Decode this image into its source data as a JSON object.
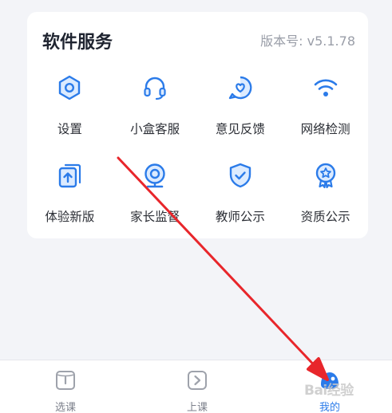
{
  "services": {
    "title": "软件服务",
    "version": "版本号: v5.1.78",
    "items": [
      {
        "label": "设置",
        "icon": "settings-hexagon-icon"
      },
      {
        "label": "小盒客服",
        "icon": "headset-icon"
      },
      {
        "label": "意见反馈",
        "icon": "feedback-heart-icon"
      },
      {
        "label": "网络检测",
        "icon": "wifi-icon"
      },
      {
        "label": "体验新版",
        "icon": "upgrade-icon"
      },
      {
        "label": "家长监督",
        "icon": "camera-icon"
      },
      {
        "label": "教师公示",
        "icon": "shield-check-icon"
      },
      {
        "label": "资质公示",
        "icon": "badge-award-icon"
      }
    ]
  },
  "tabbar": {
    "items": [
      {
        "label": "选课",
        "icon": "book-icon"
      },
      {
        "label": "上课",
        "icon": "play-icon"
      },
      {
        "label": "我的",
        "icon": "profile-icon"
      }
    ]
  },
  "watermark": "Bai经验",
  "colors": {
    "accent": "#2b7be9",
    "annotation": "#e8262b"
  }
}
